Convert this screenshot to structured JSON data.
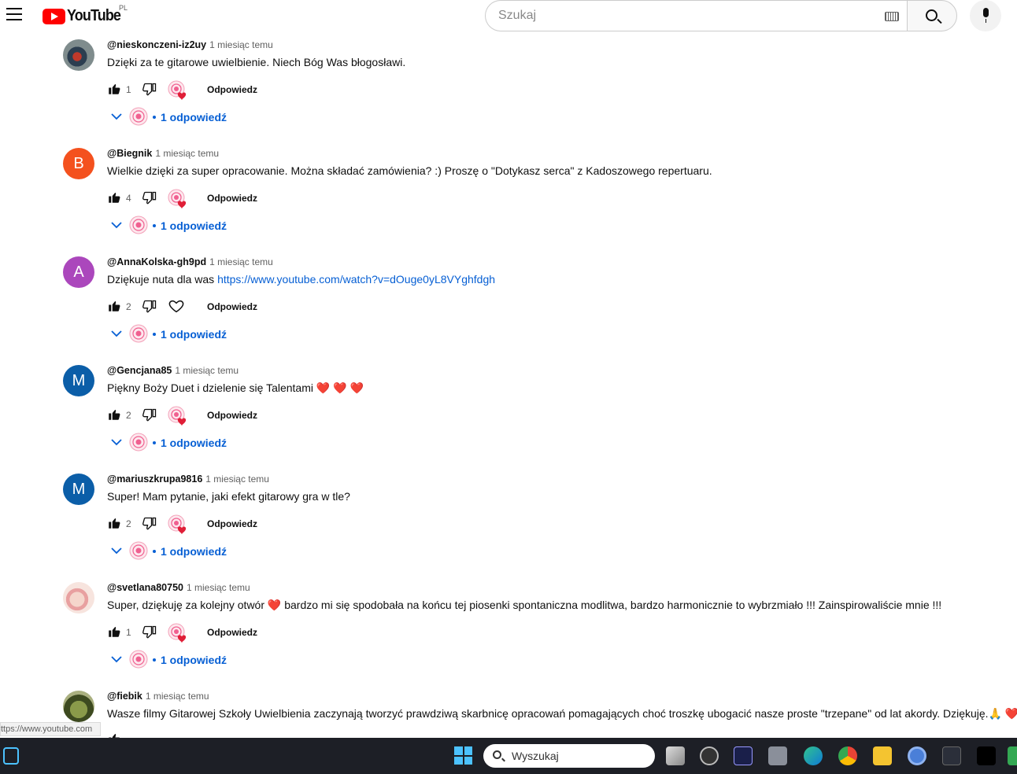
{
  "header": {
    "logo_text": "YouTube",
    "country_code": "PL",
    "search_placeholder": "Szukaj"
  },
  "comments": [
    {
      "author": "@nieskonczeni-iz2uy",
      "time": "1 miesiąc temu",
      "text": "Dzięki za te gitarowe uwielbienie. Niech Bóg Was błogosławi.",
      "likes": "1",
      "reply_label": "Odpowiedz",
      "replies_label": "1 odpowiedź",
      "avatar_letter": "",
      "avatar_color": "#5a6b7a",
      "creator_heart": true
    },
    {
      "author": "@Biegnik",
      "time": "1 miesiąc temu",
      "text": "Wielkie dzięki za super opracowanie. Można składać zamówienia? :) Proszę o \"Dotykasz serca\" z Kadoszowego repertuaru.",
      "likes": "4",
      "reply_label": "Odpowiedz",
      "replies_label": "1 odpowiedź",
      "avatar_letter": "B",
      "avatar_color": "#f4511e",
      "creator_heart": true
    },
    {
      "author": "@AnnaKolska-gh9pd",
      "time": "1 miesiąc temu",
      "text": "Dziękuje   nuta dla was ",
      "link": "https://www.youtube.com/watch?v=dOuge0yL8VYghfdgh",
      "likes": "2",
      "reply_label": "Odpowiedz",
      "replies_label": "1 odpowiedź",
      "avatar_letter": "A",
      "avatar_color": "#ab47bc",
      "creator_heart": false
    },
    {
      "author": "@Gencjana85",
      "time": "1 miesiąc temu",
      "text": "Piękny Boży Duet i dzielenie się Talentami ",
      "emoji": "❤️ ❤️ ❤️",
      "likes": "2",
      "reply_label": "Odpowiedz",
      "replies_label": "1 odpowiedź",
      "avatar_letter": "M",
      "avatar_color": "#0b5ea8",
      "creator_heart": true
    },
    {
      "author": "@mariuszkrupa9816",
      "time": "1 miesiąc temu",
      "text": "Super! Mam pytanie, jaki efekt gitarowy gra w tle?",
      "likes": "2",
      "reply_label": "Odpowiedz",
      "replies_label": "1 odpowiedź",
      "avatar_letter": "M",
      "avatar_color": "#0b5ea8",
      "creator_heart": true
    },
    {
      "author": "@svetlana80750",
      "time": "1 miesiąc temu",
      "text": "Super, dziękuję za kolejny otwór ❤️  bardzo mi się spodobała na końcu tej piosenki spontaniczna modlitwa, bardzo harmonicznie to wybrzmiało !!! Zainspirowaliście mnie !!!",
      "likes": "1",
      "reply_label": "Odpowiedz",
      "replies_label": "1 odpowiedź",
      "avatar_letter": "",
      "avatar_color": "#e8c8c0",
      "creator_heart": true
    },
    {
      "author": "@fiebik",
      "time": "1 miesiąc temu",
      "text": "Wasze filmy Gitarowej Szkoły Uwielbienia zaczynają tworzyć prawdziwą skarbnicę opracowań pomagających choć troszkę ubogacić nasze proste \"trzepane\" od lat akordy. Dziękuję.🙏 ❤️",
      "likes": "",
      "reply_label": "",
      "replies_label": "",
      "avatar_letter": "",
      "avatar_color": "#6b7a3a",
      "creator_heart": false
    }
  ],
  "status_url": "ttps://www.youtube.com",
  "taskbar": {
    "search_label": "Wyszukaj"
  }
}
